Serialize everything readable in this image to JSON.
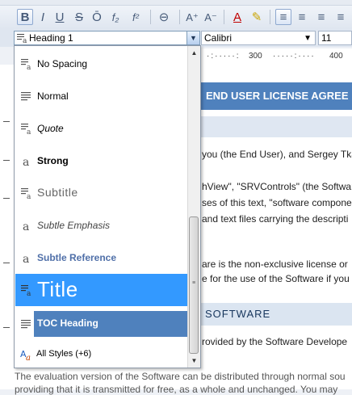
{
  "toolbar": {
    "buttons": [
      {
        "name": "bold-button",
        "glyph": "B"
      },
      {
        "name": "italic-button",
        "glyph": "I"
      },
      {
        "name": "underline-button",
        "glyph": "U"
      },
      {
        "name": "strikethrough-button",
        "glyph": "S"
      },
      {
        "name": "overline-button",
        "glyph": "Ō"
      },
      {
        "name": "subscript-button",
        "glyph": "f₂"
      },
      {
        "name": "superscript-button",
        "glyph": "f²"
      },
      {
        "name": "hyperlink-button",
        "glyph": "⊖"
      },
      {
        "name": "grow-font-button",
        "glyph": "A⁺"
      },
      {
        "name": "shrink-font-button",
        "glyph": "A⁻"
      },
      {
        "name": "font-color-button",
        "glyph": "A"
      },
      {
        "name": "highlight-button",
        "glyph": "✎"
      },
      {
        "name": "align-left-button",
        "glyph": "≡"
      },
      {
        "name": "align-center-button",
        "glyph": "≡"
      },
      {
        "name": "align-right-button",
        "glyph": "≡"
      },
      {
        "name": "justify-button",
        "glyph": "≡"
      }
    ]
  },
  "style_combo": {
    "value": "Heading 1",
    "icon": "paragraph-style-icon"
  },
  "font_combo": {
    "value": "Calibri"
  },
  "size_combo": {
    "value": "11"
  },
  "ruler": {
    "marks": [
      "300",
      "400"
    ]
  },
  "styles_list": [
    {
      "label": "No Spacing",
      "icon": "paragraph-char-style-icon"
    },
    {
      "label": "Normal",
      "icon": "paragraph-style-icon"
    },
    {
      "label": "Quote",
      "icon": "paragraph-char-style-icon"
    },
    {
      "label": "Strong",
      "icon": "character-style-icon"
    },
    {
      "label": "Subtitle",
      "icon": "paragraph-char-style-icon"
    },
    {
      "label": "Subtle Emphasis",
      "icon": "character-style-icon"
    },
    {
      "label": "Subtle Reference",
      "icon": "character-style-icon"
    },
    {
      "label": "Title",
      "icon": "paragraph-char-style-icon"
    },
    {
      "label": "TOC Heading",
      "icon": "paragraph-style-icon"
    }
  ],
  "all_styles": {
    "label": "All Styles (+6)",
    "icon": "styles-icon"
  },
  "document": {
    "heading": "END USER LICENSE AGREE",
    "lines": [
      "you (the End User), and Sergey Tkac",
      "hView\", \"SRVControls\" (the Softwar",
      "ses of this text, \"software compone",
      "and text files carrying the descripti",
      "are is the non-exclusive license or",
      "e for the use of the Software if you",
      "rovided by the Software Develope",
      "The evaluation version of the Software can be distributed through normal sou",
      "providing that it is transmitted for free, as a whole and unchanged. You may"
    ],
    "subheading": "SOFTWARE"
  },
  "colors": {
    "selected_item": "#3399ff",
    "toc_item": "#4f81bd",
    "heading_band": "#4f81bd"
  }
}
